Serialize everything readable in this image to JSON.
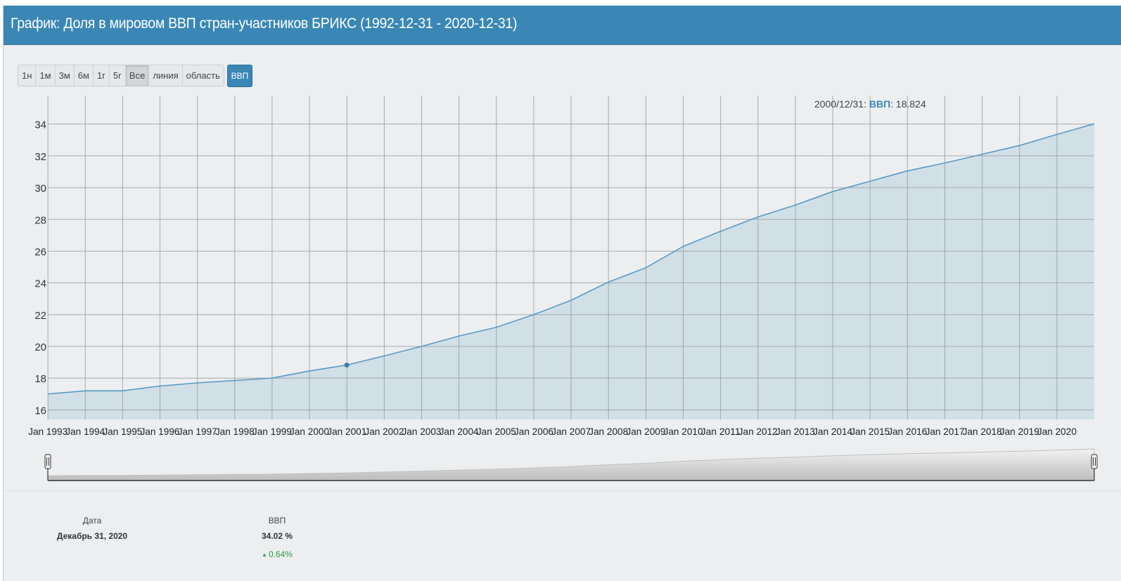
{
  "header": {
    "title": "График: Доля в мировом ВВП стран-участников БРИКС (1992-12-31 - 2020-12-31)"
  },
  "range_buttons": [
    "1н",
    "1м",
    "3м",
    "6м",
    "1г",
    "5г",
    "Все",
    "линия",
    "область"
  ],
  "active_range": "Все",
  "series_toggle": "ВВП",
  "tooltip": {
    "date": "2000/12/31",
    "series": "ВВП",
    "value": "18.824"
  },
  "summary": {
    "date_header": "Дата",
    "date_value": "Декабрь 31, 2020",
    "gdp_header": "ВВП",
    "gdp_value": "34.02 %",
    "gdp_change": "0.64%"
  },
  "colors": {
    "header": "#3a87b6",
    "line": "#5a9bc4",
    "area": "#d0dde6",
    "change_up": "#2e9a4a"
  },
  "chart_data": {
    "type": "area",
    "series": [
      {
        "name": "ВВП",
        "x": [
          "1992-12-31",
          "1993-12-31",
          "1994-12-31",
          "1995-12-31",
          "1996-12-31",
          "1997-12-31",
          "1998-12-31",
          "1999-12-31",
          "2000-12-31",
          "2001-12-31",
          "2002-12-31",
          "2003-12-31",
          "2004-12-31",
          "2005-12-31",
          "2006-12-31",
          "2007-12-31",
          "2008-12-31",
          "2009-12-31",
          "2010-12-31",
          "2011-12-31",
          "2012-12-31",
          "2013-12-31",
          "2014-12-31",
          "2015-12-31",
          "2016-12-31",
          "2017-12-31",
          "2018-12-31",
          "2019-12-31",
          "2020-12-31"
        ],
        "values": [
          17.0,
          17.2,
          17.2,
          17.5,
          17.7,
          17.85,
          18.0,
          18.45,
          18.824,
          19.4,
          20.0,
          20.65,
          21.2,
          22.0,
          22.9,
          24.05,
          24.95,
          26.3,
          27.25,
          28.15,
          28.9,
          29.75,
          30.4,
          31.05,
          31.55,
          32.1,
          32.65,
          33.35,
          34.02
        ]
      }
    ],
    "x_ticks": [
      "Jan 1993",
      "Jan 1994",
      "Jan 1995",
      "Jan 1996",
      "Jan 1997",
      "Jan 1998",
      "Jan 1999",
      "Jan 2000",
      "Jan 2001",
      "Jan 2002",
      "Jan 2003",
      "Jan 2004",
      "Jan 2005",
      "Jan 2006",
      "Jan 2007",
      "Jan 2008",
      "Jan 2009",
      "Jan 2010",
      "Jan 2011",
      "Jan 2012",
      "Jan 2013",
      "Jan 2014",
      "Jan 2015",
      "Jan 2016",
      "Jan 2017",
      "Jan 2018",
      "Jan 2019",
      "Jan 2020"
    ],
    "y_ticks": [
      16,
      18,
      20,
      22,
      24,
      26,
      28,
      30,
      32,
      34
    ],
    "ylim": [
      15.4,
      35.8
    ],
    "grid": true,
    "highlight_index": 8,
    "navigator": true
  }
}
